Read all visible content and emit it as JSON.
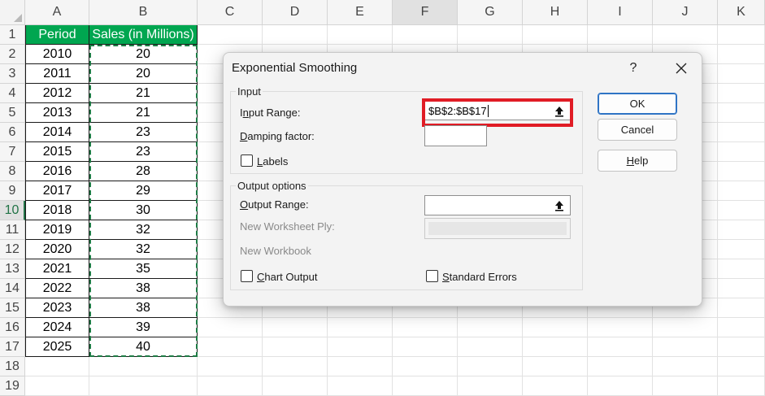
{
  "sheet": {
    "columns": [
      "A",
      "B",
      "C",
      "D",
      "E",
      "F",
      "G",
      "H",
      "I",
      "J",
      "K"
    ],
    "selected_column": "F",
    "rows": [
      "1",
      "2",
      "3",
      "4",
      "5",
      "6",
      "7",
      "8",
      "9",
      "10",
      "11",
      "12",
      "13",
      "14",
      "15",
      "16",
      "17",
      "18",
      "19"
    ],
    "selected_row": "10",
    "header": [
      "Period",
      "Sales (in Millions)"
    ],
    "data": [
      [
        "2010",
        "20"
      ],
      [
        "2011",
        "20"
      ],
      [
        "2012",
        "21"
      ],
      [
        "2013",
        "21"
      ],
      [
        "2014",
        "23"
      ],
      [
        "2015",
        "23"
      ],
      [
        "2016",
        "28"
      ],
      [
        "2017",
        "29"
      ],
      [
        "2018",
        "30"
      ],
      [
        "2019",
        "32"
      ],
      [
        "2020",
        "32"
      ],
      [
        "2021",
        "35"
      ],
      [
        "2022",
        "38"
      ],
      [
        "2023",
        "38"
      ],
      [
        "2024",
        "39"
      ],
      [
        "2025",
        "40"
      ]
    ],
    "header_color": "#00a650",
    "marquee_color": "#1e7b45"
  },
  "dialog": {
    "title": "Exponential Smoothing",
    "help_glyph": "?",
    "input_group": {
      "legend": "Input",
      "input_range_label_pre": "I",
      "input_range_label_ul": "n",
      "input_range_label_post": "put Range:",
      "input_range_value": "$B$2:$B$17",
      "damping_label_pre": "",
      "damping_label_ul": "D",
      "damping_label_post": "amping factor:",
      "damping_value": "",
      "labels_label_pre": "",
      "labels_label_ul": "L",
      "labels_label_post": "abels",
      "labels_checked": false
    },
    "output_group": {
      "legend": "Output options",
      "output_range_label_pre": "",
      "output_range_label_ul": "O",
      "output_range_label_post": "utput Range:",
      "output_range_value": "",
      "new_ply_label": "New Worksheet Ply:",
      "new_workbook_label": "New Workbook",
      "chart_output_label_pre": "",
      "chart_output_label_ul": "C",
      "chart_output_label_post": "hart Output",
      "chart_output_checked": false,
      "std_errors_label_pre": "",
      "std_errors_label_ul": "S",
      "std_errors_label_post": "tandard Errors",
      "std_errors_checked": false
    },
    "buttons": {
      "ok": "OK",
      "cancel": "Cancel",
      "help_pre": "",
      "help_ul": "H",
      "help_post": "elp"
    },
    "highlight_color": "#e01c25"
  }
}
